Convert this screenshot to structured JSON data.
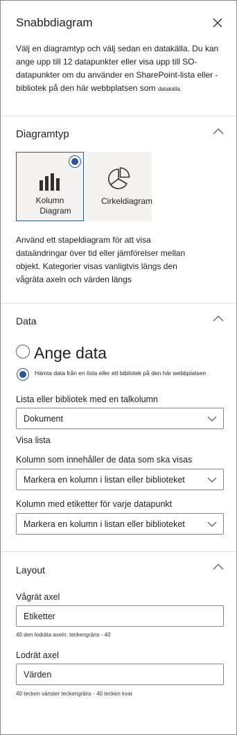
{
  "panel": {
    "title": "Snabbdiagram",
    "intro_main": "Välj en diagramtyp och välj sedan en datakälla. Du kan ange upp till 12 datapunkter eller visa upp till SO-datapunkter om du använder en SharePoint-lista eller -bibliotek på den här webbplatsen som",
    "intro_small": "datakälla."
  },
  "chart_type": {
    "title": "Diagramtyp",
    "column_label_1": "Kolumn",
    "column_label_2": "Diagram",
    "pie_label": "Cirkeldiagram",
    "description": "Använd ett stapeldiagram för att visa dataändringar över tid eller jämförelser mellan objekt. Kategorier visas vanligtvis längs den vågräta axeln och värden längs"
  },
  "data": {
    "title": "Data",
    "option_manual": "Ange data",
    "option_list": "Hämta data från en lista eller ett bibliotek på den här webbplatsen",
    "list_label": "Lista eller bibliotek med en talkolumn",
    "list_value": "Dokument",
    "show_list_label": "Visa lista",
    "values_column_label": "Kolumn som innehåller de data som ska visas",
    "values_column_value": "Markera en kolumn i listan eller biblioteket",
    "labels_column_label": "Kolumn med etiketter för varje datapunkt",
    "labels_column_value": "Markera en kolumn i listan eller biblioteket"
  },
  "layout": {
    "title": "Layout",
    "x_axis_label": "Vågrät axel",
    "x_axis_value": "Etiketter",
    "x_axis_hint_num": "40",
    "x_axis_hint": "den lodräta axeln. teckengräns - 40",
    "y_axis_label": "Lodrät axel",
    "y_axis_value": "Värden",
    "y_axis_hint_num": "40",
    "y_axis_hint": "tecken vänster teckengräns - 40 tecken kvar"
  },
  "colors": {
    "accent": "#2b579a",
    "border": "#8a8886",
    "divider": "#e1dfdd",
    "tile_bg": "#f3f2f1"
  }
}
